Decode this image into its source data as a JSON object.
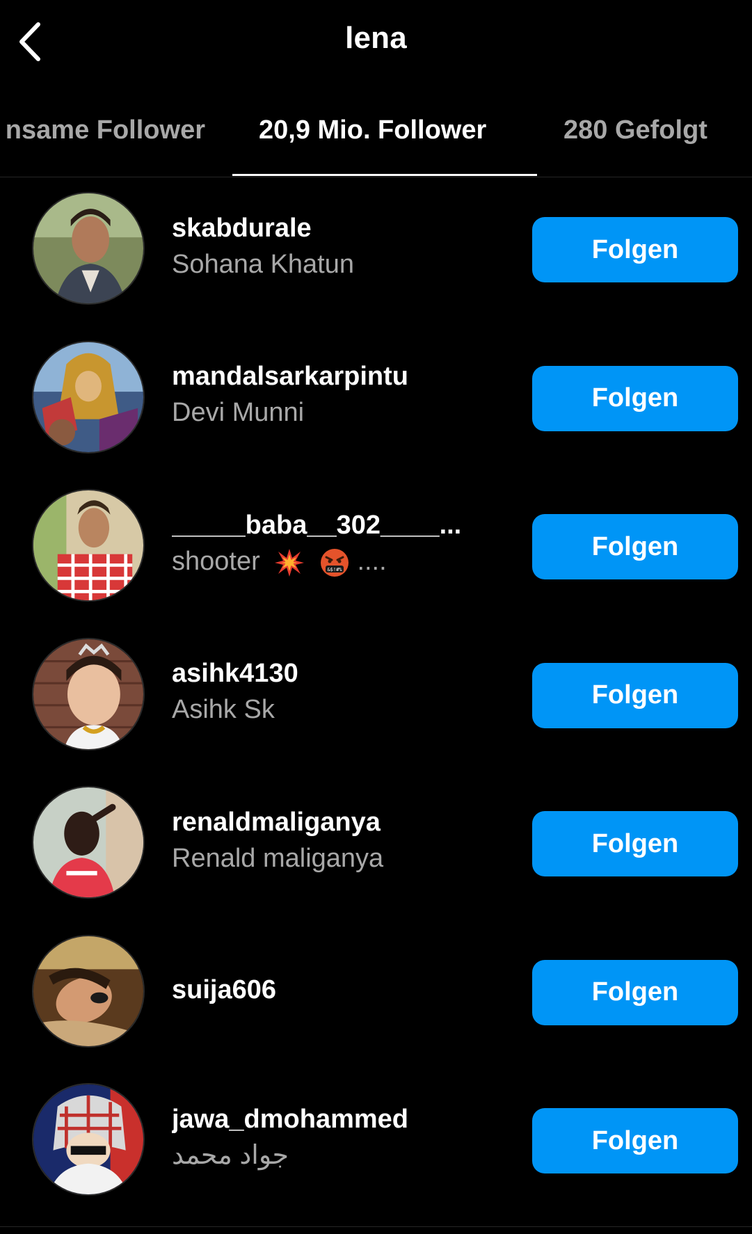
{
  "header": {
    "title": "lena",
    "back_icon": "chevron-left-icon"
  },
  "tabs": [
    {
      "label": "Gemeinsame Follower",
      "visible_label": "nsame Follower",
      "active": false
    },
    {
      "label": "20,9 Mio. Follower",
      "active": true
    },
    {
      "label": "280 Gefolgt",
      "active": false
    }
  ],
  "followers": [
    {
      "username": "skabdurale",
      "fullname": "Sohana Khatun",
      "button": "Folgen"
    },
    {
      "username": "mandalsarkarpintu",
      "fullname": "Devi Munni",
      "button": "Folgen"
    },
    {
      "username": "_____baba__302____...",
      "fullname": "shooter",
      "fullname_suffix": "....",
      "emojis": [
        "collision-emoji",
        "cursing-face-emoji"
      ],
      "button": "Folgen"
    },
    {
      "username": "asihk4130",
      "fullname": "Asihk Sk",
      "button": "Folgen"
    },
    {
      "username": "renaldmaliganya",
      "fullname": "Renald maliganya",
      "button": "Folgen"
    },
    {
      "username": "suija606",
      "fullname": "",
      "button": "Folgen"
    },
    {
      "username": "jawa_dmohammed",
      "fullname": "جواد محمد",
      "button": "Folgen"
    }
  ],
  "colors": {
    "background": "#000000",
    "primary_text": "#ffffff",
    "secondary_text": "#a8a8a8",
    "button": "#0095f6",
    "divider": "#262626"
  }
}
